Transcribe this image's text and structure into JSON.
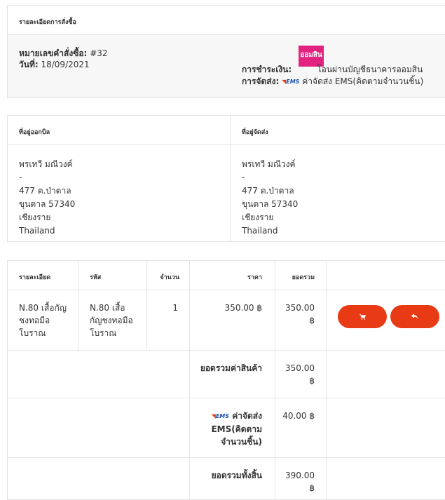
{
  "order": {
    "header": "รายละเอียดการสั่งซื้อ",
    "number_label": "หมายเลขคำสั่งซื้อ:",
    "number_value": "#32",
    "date_label": "วันที่:",
    "date_value": "18/09/2021",
    "bank_logo_text": "ออมสิน",
    "payment_label": "การชำระเงิน:",
    "payment_value": "โอนผ่านบัญชีธนาคารออมสิน",
    "shipping_label": "การจัดส่ง:",
    "shipping_badge": "EMS",
    "shipping_value": "ค่าจัดส่ง EMS(คิดตามจำนวนชิ้น)"
  },
  "billing": {
    "header": "ที่อยู่ออกบิล",
    "lines": [
      "พรเทวี มณีวงค์",
      "-",
      "477 ต.ป่าตาล",
      "ขุนตาล 57340",
      "เชียงราย",
      "Thailand"
    ]
  },
  "shipping_address": {
    "header": "ที่อยู่จัดส่ง",
    "lines": [
      "พรเทวี มณีวงค์",
      "-",
      "477 ต.ป่าตาล",
      "ขุนตาล 57340",
      "เชียงราย",
      "Thailand"
    ]
  },
  "items": {
    "columns": [
      "รายละเอียด",
      "รหัส",
      "จำนวน",
      "ราคา",
      "ยอดรวม"
    ],
    "rows": [
      {
        "detail": "N.80 เสื้อกัญชงทอมือโบราณ",
        "code": "N.80 เสื้อกัญชงทอมือโบราณ",
        "qty": "1",
        "price": "350.00 ฿",
        "total": "350.00 ฿"
      }
    ],
    "cart_icon": "cart-icon",
    "return_icon": "reply-icon",
    "subtotal_label": "ยอดรวมค่าสินค้า",
    "subtotal_value": "350.00 ฿",
    "shipping_badge": "EMS",
    "shipping_label": "ค่าจัดส่ง EMS(คิดตามจำนวนชิ้น)",
    "shipping_value": "40.00 ฿",
    "grand_label": "ยอดรวมทั้งสิ้น",
    "grand_value": "390.00 ฿"
  },
  "colors": {
    "accent": "#e83a14",
    "bank": "#e2227e",
    "border": "#e4e4e4"
  }
}
